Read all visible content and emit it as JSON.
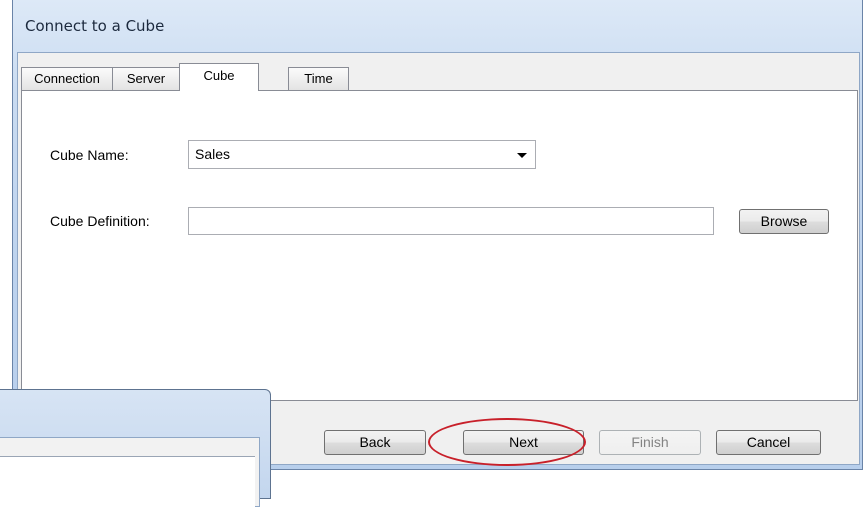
{
  "dialog": {
    "title": "Connect to a Cube",
    "tabs": [
      {
        "label": "Connection",
        "active": false
      },
      {
        "label": "Server",
        "active": false
      },
      {
        "label": "Cube",
        "active": true
      },
      {
        "label": "Time",
        "active": false
      }
    ],
    "cube_name": {
      "label": "Cube Name:",
      "value": "Sales"
    },
    "cube_definition": {
      "label": "Cube Definition:",
      "value": "",
      "browse_label": "Browse"
    },
    "buttons": {
      "back": "Back",
      "next": "Next",
      "finish": "Finish",
      "cancel": "Cancel"
    }
  },
  "annotation": {
    "highlight_color": "#c8202a",
    "highlighted_control": "next-button"
  },
  "colors": {
    "title_bar": "#c9dbf1",
    "panel": "#ffffff",
    "client": "#f0f0f0"
  }
}
